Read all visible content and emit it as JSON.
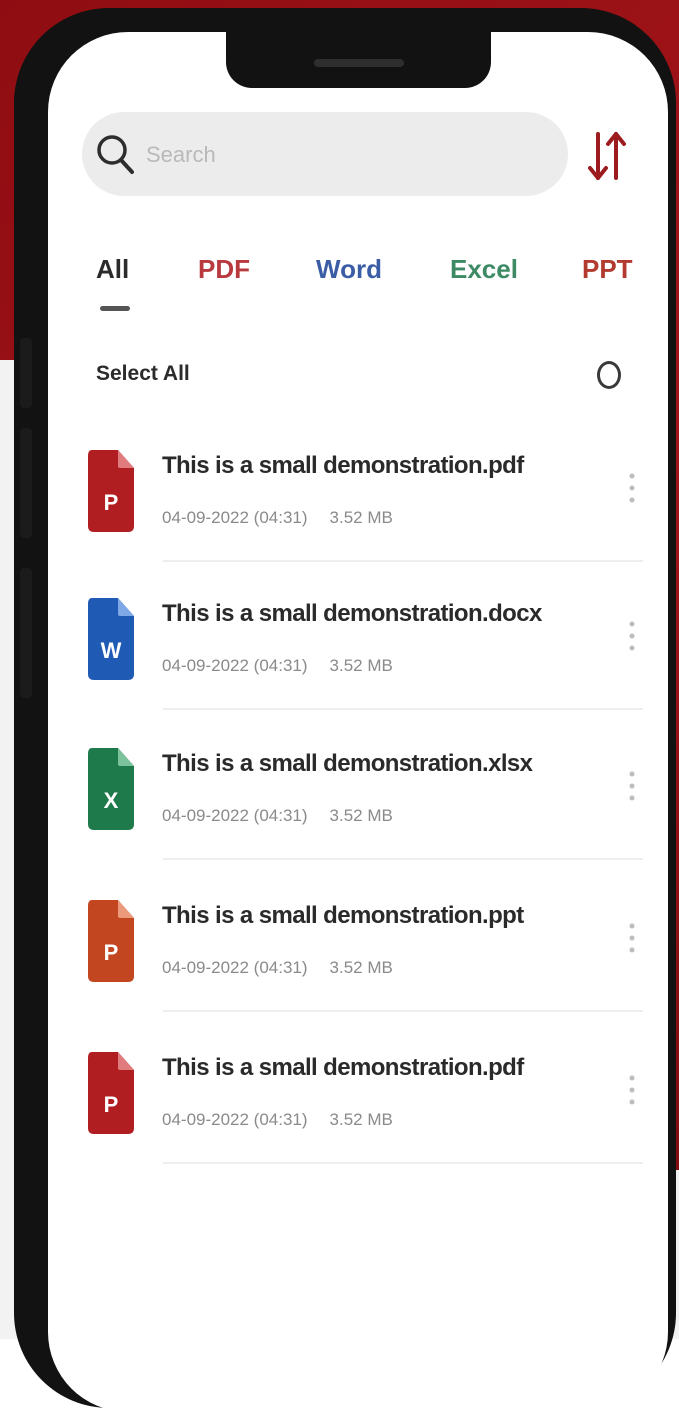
{
  "search": {
    "placeholder": "Search",
    "icon": "search-icon"
  },
  "sort": {
    "icon": "sort-arrows-icon",
    "color": "#9b1b1f"
  },
  "tabs": [
    {
      "label": "All",
      "color": "#2b2b2b",
      "active": true
    },
    {
      "label": "PDF",
      "color": "#b83a3f",
      "active": false
    },
    {
      "label": "Word",
      "color": "#3b5da6",
      "active": false
    },
    {
      "label": "Excel",
      "color": "#3e8a65",
      "active": false
    },
    {
      "label": "PPT",
      "color": "#b23a2f",
      "active": false
    }
  ],
  "select_all": {
    "label": "Select All"
  },
  "files": [
    {
      "name": "This is a small demonstration.pdf",
      "date": "04-09-2022 (04:31)",
      "size": "3.52 MB",
      "type": "pdf",
      "letter": "P",
      "icon_color": "#b01e22",
      "icon": "pdf-file-icon"
    },
    {
      "name": "This is a small demonstration.docx",
      "date": "04-09-2022 (04:31)",
      "size": "3.52 MB",
      "type": "word",
      "letter": "W",
      "icon_color": "#1f5bb5",
      "icon": "word-file-icon"
    },
    {
      "name": "This is a small demonstration.xlsx",
      "date": "04-09-2022 (04:31)",
      "size": "3.52 MB",
      "type": "excel",
      "letter": "X",
      "icon_color": "#1e7a4a",
      "icon": "excel-file-icon"
    },
    {
      "name": "This is a small demonstration.ppt",
      "date": "04-09-2022 (04:31)",
      "size": "3.52 MB",
      "type": "ppt",
      "letter": "P",
      "icon_color": "#c2461f",
      "icon": "ppt-file-icon"
    },
    {
      "name": "This is a small demonstration.pdf",
      "date": "04-09-2022 (04:31)",
      "size": "3.52 MB",
      "type": "pdf",
      "letter": "P",
      "icon_color": "#b01e22",
      "icon": "pdf-file-icon"
    }
  ]
}
